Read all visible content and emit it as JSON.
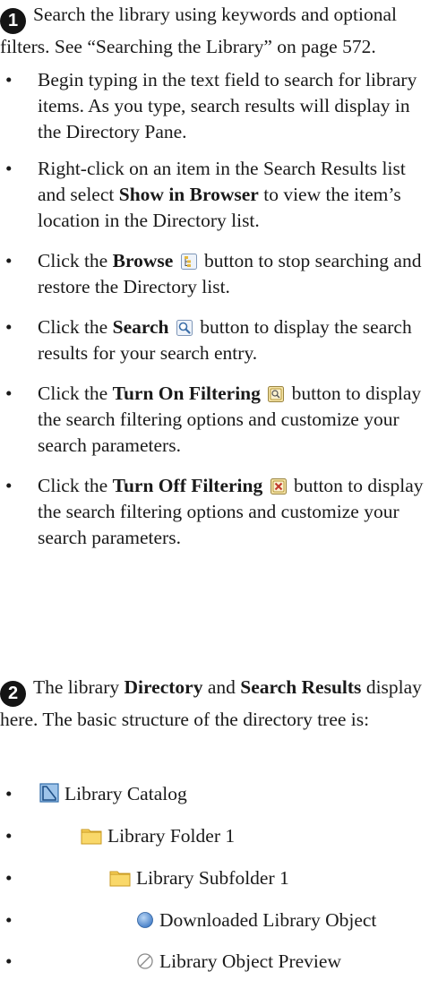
{
  "section1": {
    "badge": "1",
    "intro": "Search the library using keywords and optional filters. See “Searching the Library” on page 572.",
    "bullets": [
      {
        "text": "Begin typing in the text field to search for library items. As you type, search results will display in the Directory Pane."
      },
      {
        "pre": "Right-click on an item in the Search Results list and select ",
        "bold": "Show in Browser",
        "post": " to view the item’s location in the Directory list."
      },
      {
        "pre": "Click the ",
        "bold": "Browse",
        "icon": "browse-icon",
        "post": " button to stop searching and restore the Directory list."
      },
      {
        "pre": "Click the ",
        "bold": "Search",
        "icon": "search-icon",
        "post": " button to display the search results for your search entry."
      },
      {
        "pre": "Click the ",
        "bold": "Turn On Filtering",
        "icon": "filter-on-icon",
        "post": " button to display the search filtering options and customize your search parameters."
      },
      {
        "pre": "Click the ",
        "bold": "Turn Off Filtering",
        "icon": "filter-off-icon",
        "post": " button to display the search filtering options and customize your search parameters."
      }
    ]
  },
  "section2": {
    "badge": "2",
    "intro_pre": "The library ",
    "intro_bold1": "Directory",
    "intro_mid": " and ",
    "intro_bold2": "Search Results",
    "intro_post": " display here. The basic structure of the directory tree is:",
    "tree": [
      {
        "label": "Library Catalog",
        "icon": "library-catalog-icon",
        "level": 0
      },
      {
        "label": "Library Folder 1",
        "icon": "folder-icon",
        "level": 1
      },
      {
        "label": "Library Subfolder 1",
        "icon": "folder-icon",
        "level": 2
      },
      {
        "label": "Downloaded Library Object",
        "icon": "downloaded-object-icon",
        "level": 3
      },
      {
        "label": "Library Object Preview",
        "icon": "object-preview-icon",
        "level": 3
      }
    ]
  },
  "colors": {
    "text": "#1a1a1a",
    "badge": "#141414",
    "folder": "#f2c64a",
    "catalog": "#3c7fc6",
    "object": "#4a86cf"
  }
}
